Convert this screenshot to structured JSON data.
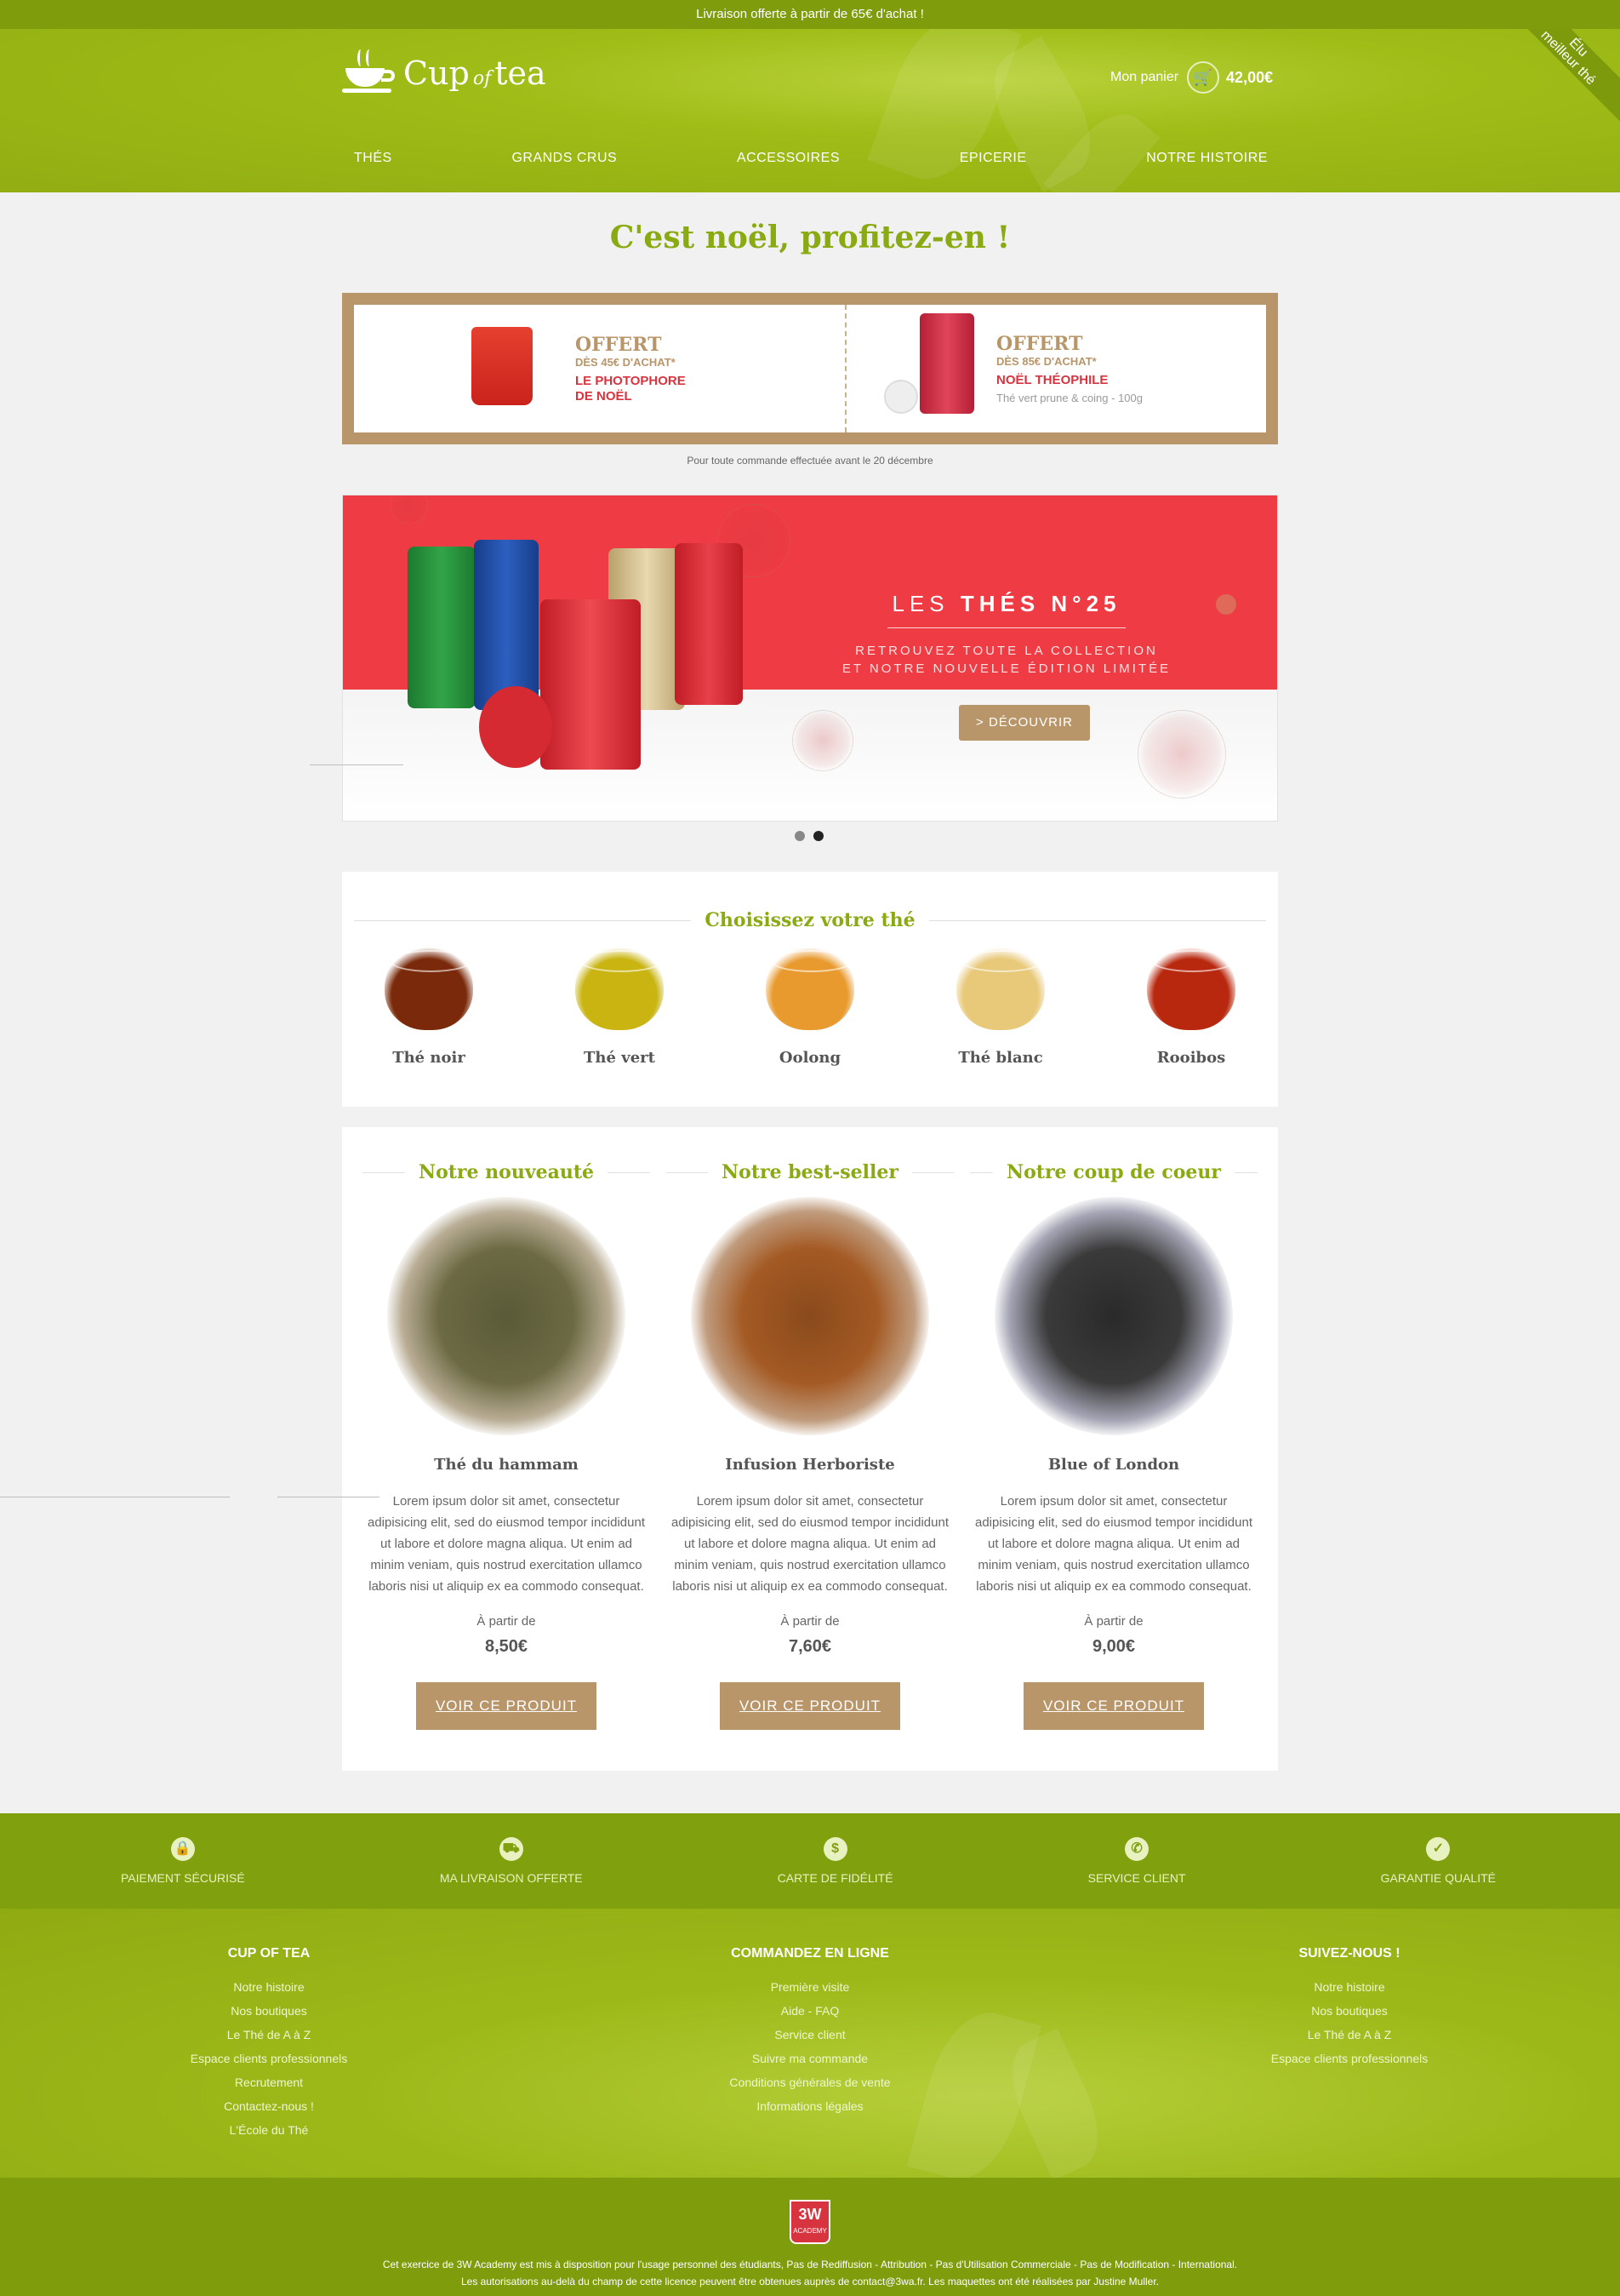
{
  "topbar": {
    "text": "Livraison offerte à partir de 65€ d'achat !"
  },
  "ribbon": {
    "line1": "Élu",
    "line2": "meilleur thé"
  },
  "logo": {
    "cup": "Cup",
    "of": "of",
    "tea": "tea",
    "icon": "teacup-icon"
  },
  "cart": {
    "label": "Mon panier",
    "icon": "cart-icon",
    "total": "42,00€"
  },
  "nav": [
    "THÉS",
    "GRANDS CRUS",
    "ACCESSOIRES",
    "EPICERIE",
    "NOTRE HISTOIRE"
  ],
  "page_title": "C'est noël, profitez-en !",
  "promo": {
    "left": {
      "title": "OFFERT",
      "sub": "DÈS 45€ D'ACHAT*",
      "gift1": "LE PHOTOPHORE",
      "gift2": "DE NOËL"
    },
    "right": {
      "title": "OFFERT",
      "sub": "DÈS 85€ D'ACHAT*",
      "gift1": "NOËL THÉOPHILE",
      "desc": "Thé vert prune & coing - 100g"
    },
    "note": "Pour toute commande effectuée avant le 20 décembre"
  },
  "slider": {
    "title_light": "LES ",
    "title_bold": "THÉS N°25",
    "sub1": "RETROUVEZ TOUTE LA COLLECTION",
    "sub2": "ET NOTRE NOUVELLE ÉDITION LIMITÉE",
    "button": "> DÉCOUVRIR",
    "dots": 2,
    "active_dot": 2
  },
  "tea_types": {
    "heading": "Choisissez votre thé",
    "items": [
      {
        "name": "Thé noir",
        "color": "#7a2a0a"
      },
      {
        "name": "Thé vert",
        "color": "#c9b412"
      },
      {
        "name": "Oolong",
        "color": "#e89a2e"
      },
      {
        "name": "Thé blanc",
        "color": "#e8c97a"
      },
      {
        "name": "Rooibos",
        "color": "#b8280e"
      }
    ]
  },
  "products": [
    {
      "heading": "Notre nouveauté",
      "name": "Thé du hammam",
      "desc": "Lorem ipsum dolor sit amet, consectetur adipisicing elit, sed do eiusmod tempor incididunt ut labore et dolore magna aliqua. Ut enim ad minim veniam, quis nostrud exercitation ullamco laboris nisi ut aliquip ex ea commodo consequat.",
      "from": "À partir de",
      "price": "8,50€",
      "button": "VOIR CE PRODUIT"
    },
    {
      "heading": "Notre best-seller",
      "name": "Infusion Herboriste",
      "desc": "Lorem ipsum dolor sit amet, consectetur adipisicing elit, sed do eiusmod tempor incididunt ut labore et dolore magna aliqua. Ut enim ad minim veniam, quis nostrud exercitation ullamco laboris nisi ut aliquip ex ea commodo consequat.",
      "from": "À partir de",
      "price": "7,60€",
      "button": "VOIR CE PRODUIT"
    },
    {
      "heading": "Notre coup de coeur",
      "name": "Blue of London",
      "desc": "Lorem ipsum dolor sit amet, consectetur adipisicing elit, sed do eiusmod tempor incididunt ut labore et dolore magna aliqua. Ut enim ad minim veniam, quis nostrud exercitation ullamco laboris nisi ut aliquip ex ea commodo consequat.",
      "from": "À partir de",
      "price": "9,00€",
      "button": "VOIR CE PRODUIT"
    }
  ],
  "reassurance": [
    {
      "icon": "lock-icon",
      "label": "PAIEMENT SÉCURISÉ"
    },
    {
      "icon": "truck-icon",
      "label": "MA LIVRAISON OFFERTE"
    },
    {
      "icon": "banknote-icon",
      "label": "CARTE DE FIDÉLITÉ"
    },
    {
      "icon": "phone-icon",
      "label": "SERVICE CLIENT"
    },
    {
      "icon": "check-icon",
      "label": "GARANTIE QUALITÉ"
    }
  ],
  "footer": {
    "col1": {
      "title": "CUP OF TEA",
      "links": [
        "Notre histoire",
        "Nos boutiques",
        "Le Thé de A à Z",
        "Espace clients professionnels",
        "Recrutement",
        "Contactez-nous !",
        "L'École du Thé"
      ]
    },
    "col2": {
      "title": "COMMANDEZ EN LIGNE",
      "links": [
        "Première visite",
        "Aide - FAQ",
        "Service client",
        "Suivre ma commande",
        "Conditions générales de vente",
        "Informations légales"
      ]
    },
    "col3": {
      "title": "SUIVEZ-NOUS !",
      "links": [
        "Notre histoire",
        "Nos boutiques",
        "Le Thé de A à Z",
        "Espace clients professionnels"
      ]
    }
  },
  "badge": {
    "text": "3W",
    "sub": "ACADEMY"
  },
  "legal": {
    "line1": "Cet exercice de 3W Academy est mis à disposition pour l'usage personnel des étudiants, Pas de Rediffusion - Attribution - Pas d'Utilisation Commerciale - Pas de Modification - International.",
    "line2": "Les autorisations au-delà du champ de cette licence peuvent être obtenues auprès de contact@3wa.fr. Les maquettes ont été réalisées par Justine Muller."
  }
}
